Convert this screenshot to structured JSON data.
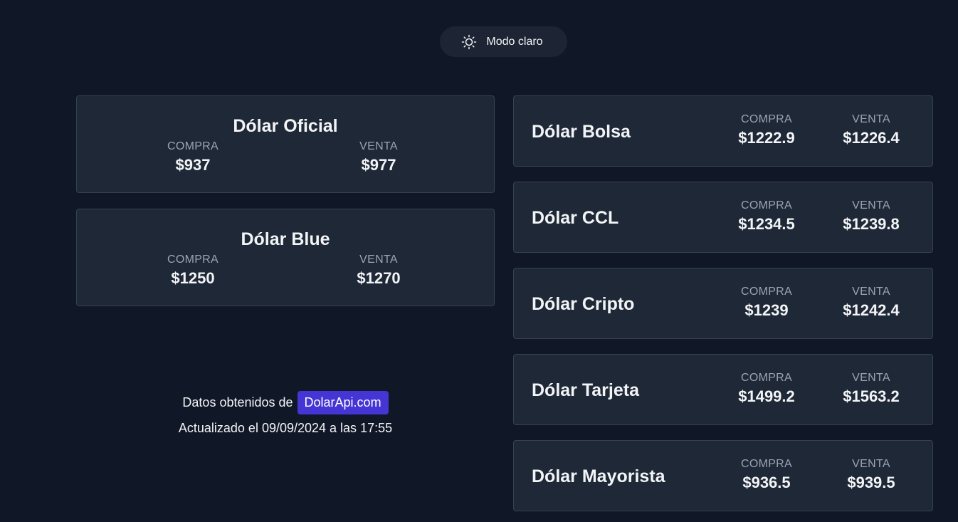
{
  "theme_toggle": {
    "label": "Modo claro",
    "icon": "sun-icon"
  },
  "labels": {
    "compra": "COMPRA",
    "venta": "VENTA"
  },
  "left_cards": [
    {
      "title": "Dólar Oficial",
      "compra": "$937",
      "venta": "$977"
    },
    {
      "title": "Dólar Blue",
      "compra": "$1250",
      "venta": "$1270"
    }
  ],
  "right_cards": [
    {
      "title": "Dólar Bolsa",
      "compra": "$1222.9",
      "venta": "$1226.4"
    },
    {
      "title": "Dólar CCL",
      "compra": "$1234.5",
      "venta": "$1239.8"
    },
    {
      "title": "Dólar Cripto",
      "compra": "$1239",
      "venta": "$1242.4"
    },
    {
      "title": "Dólar Tarjeta",
      "compra": "$1499.2",
      "venta": "$1563.2"
    },
    {
      "title": "Dólar Mayorista",
      "compra": "$936.5",
      "venta": "$939.5"
    }
  ],
  "credits": {
    "prefix": "Datos obtenidos de",
    "link_text": "DolarApi.com",
    "updated": "Actualizado el 09/09/2024 a las 17:55"
  },
  "colors": {
    "background": "#101828",
    "card": "#1e2837",
    "card_border": "#364152",
    "link_bg": "#4535d4",
    "muted_text": "#9aa4b2"
  }
}
